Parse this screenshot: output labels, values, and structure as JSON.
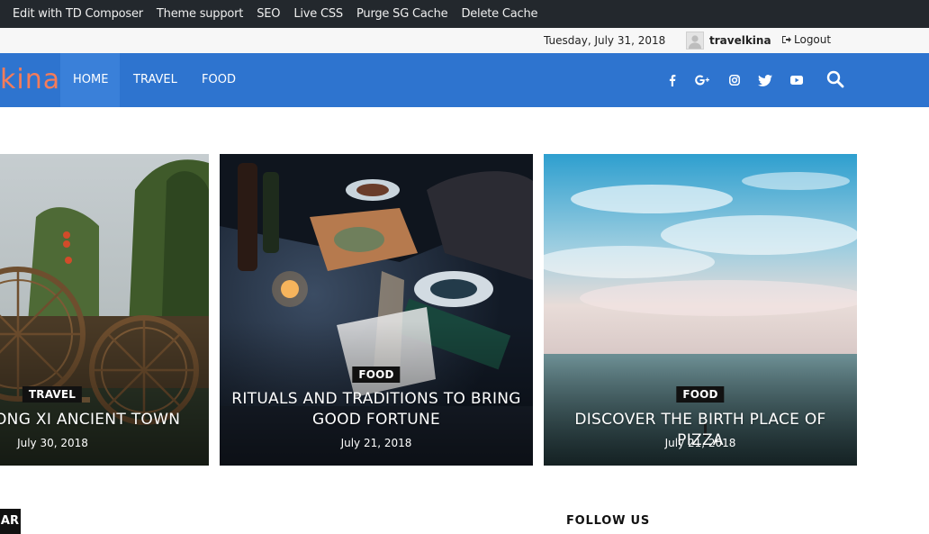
{
  "admin_bar": {
    "items": [
      "Edit with TD Composer",
      "Theme support",
      "SEO",
      "Live CSS",
      "Purge SG Cache",
      "Delete Cache"
    ]
  },
  "top_bar": {
    "date": "Tuesday, July 31, 2018",
    "username": "travelkina",
    "logout": "Logout"
  },
  "header": {
    "logo_text": "kina",
    "nav": [
      "HOME",
      "TRAVEL",
      "FOOD"
    ],
    "social_icons": [
      "facebook-icon",
      "google-plus-icon",
      "instagram-icon",
      "twitter-icon",
      "youtube-icon"
    ],
    "search_icon": "search-icon",
    "brand_color": "#2e74cf",
    "logo_color": "#f47c5a"
  },
  "posts": [
    {
      "category": "TRAVEL",
      "title": "ONG XI ANCIENT TOWN",
      "date": "July 30, 2018"
    },
    {
      "category": "FOOD",
      "title": "RITUALS AND TRADITIONS TO BRING GOOD FORTUNE",
      "date": "July 21, 2018"
    },
    {
      "category": "FOOD",
      "title": "DISCOVER THE BIRTH PLACE OF PIZZA",
      "date": "July 21, 2018"
    }
  ],
  "bottom": {
    "left_label": "AR",
    "follow_us": "FOLLOW US"
  }
}
